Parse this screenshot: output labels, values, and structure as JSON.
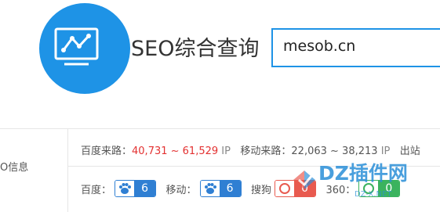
{
  "header": {
    "title": "SEO综合查询",
    "search_value": "mesob.cn"
  },
  "sidebar": {
    "label": "O信息"
  },
  "traffic": {
    "baidu_label": "百度来路：",
    "baidu_value": "40,731 ~ 61,529",
    "baidu_unit": "IP",
    "mobile_label": "移动来路：",
    "mobile_value": "22,063 ~ 38,213",
    "mobile_unit": "IP",
    "out_label": "出站"
  },
  "weights": {
    "baidu_label": "百度：",
    "baidu_value": "6",
    "mobile_label": "移动：",
    "mobile_value": "6",
    "sogou_label": "搜狗",
    "sogou_value": "0",
    "so360_label": "360：",
    "so360_value": "0"
  },
  "watermark": {
    "text": "DZ插件网",
    "sub": "DZ-X.NET"
  },
  "colors": {
    "accent": "#1e93e6",
    "red": "#e33131",
    "badge_blue": "#2f7fd3",
    "badge_red": "#e85a4f",
    "badge_green": "#3bb35e"
  }
}
